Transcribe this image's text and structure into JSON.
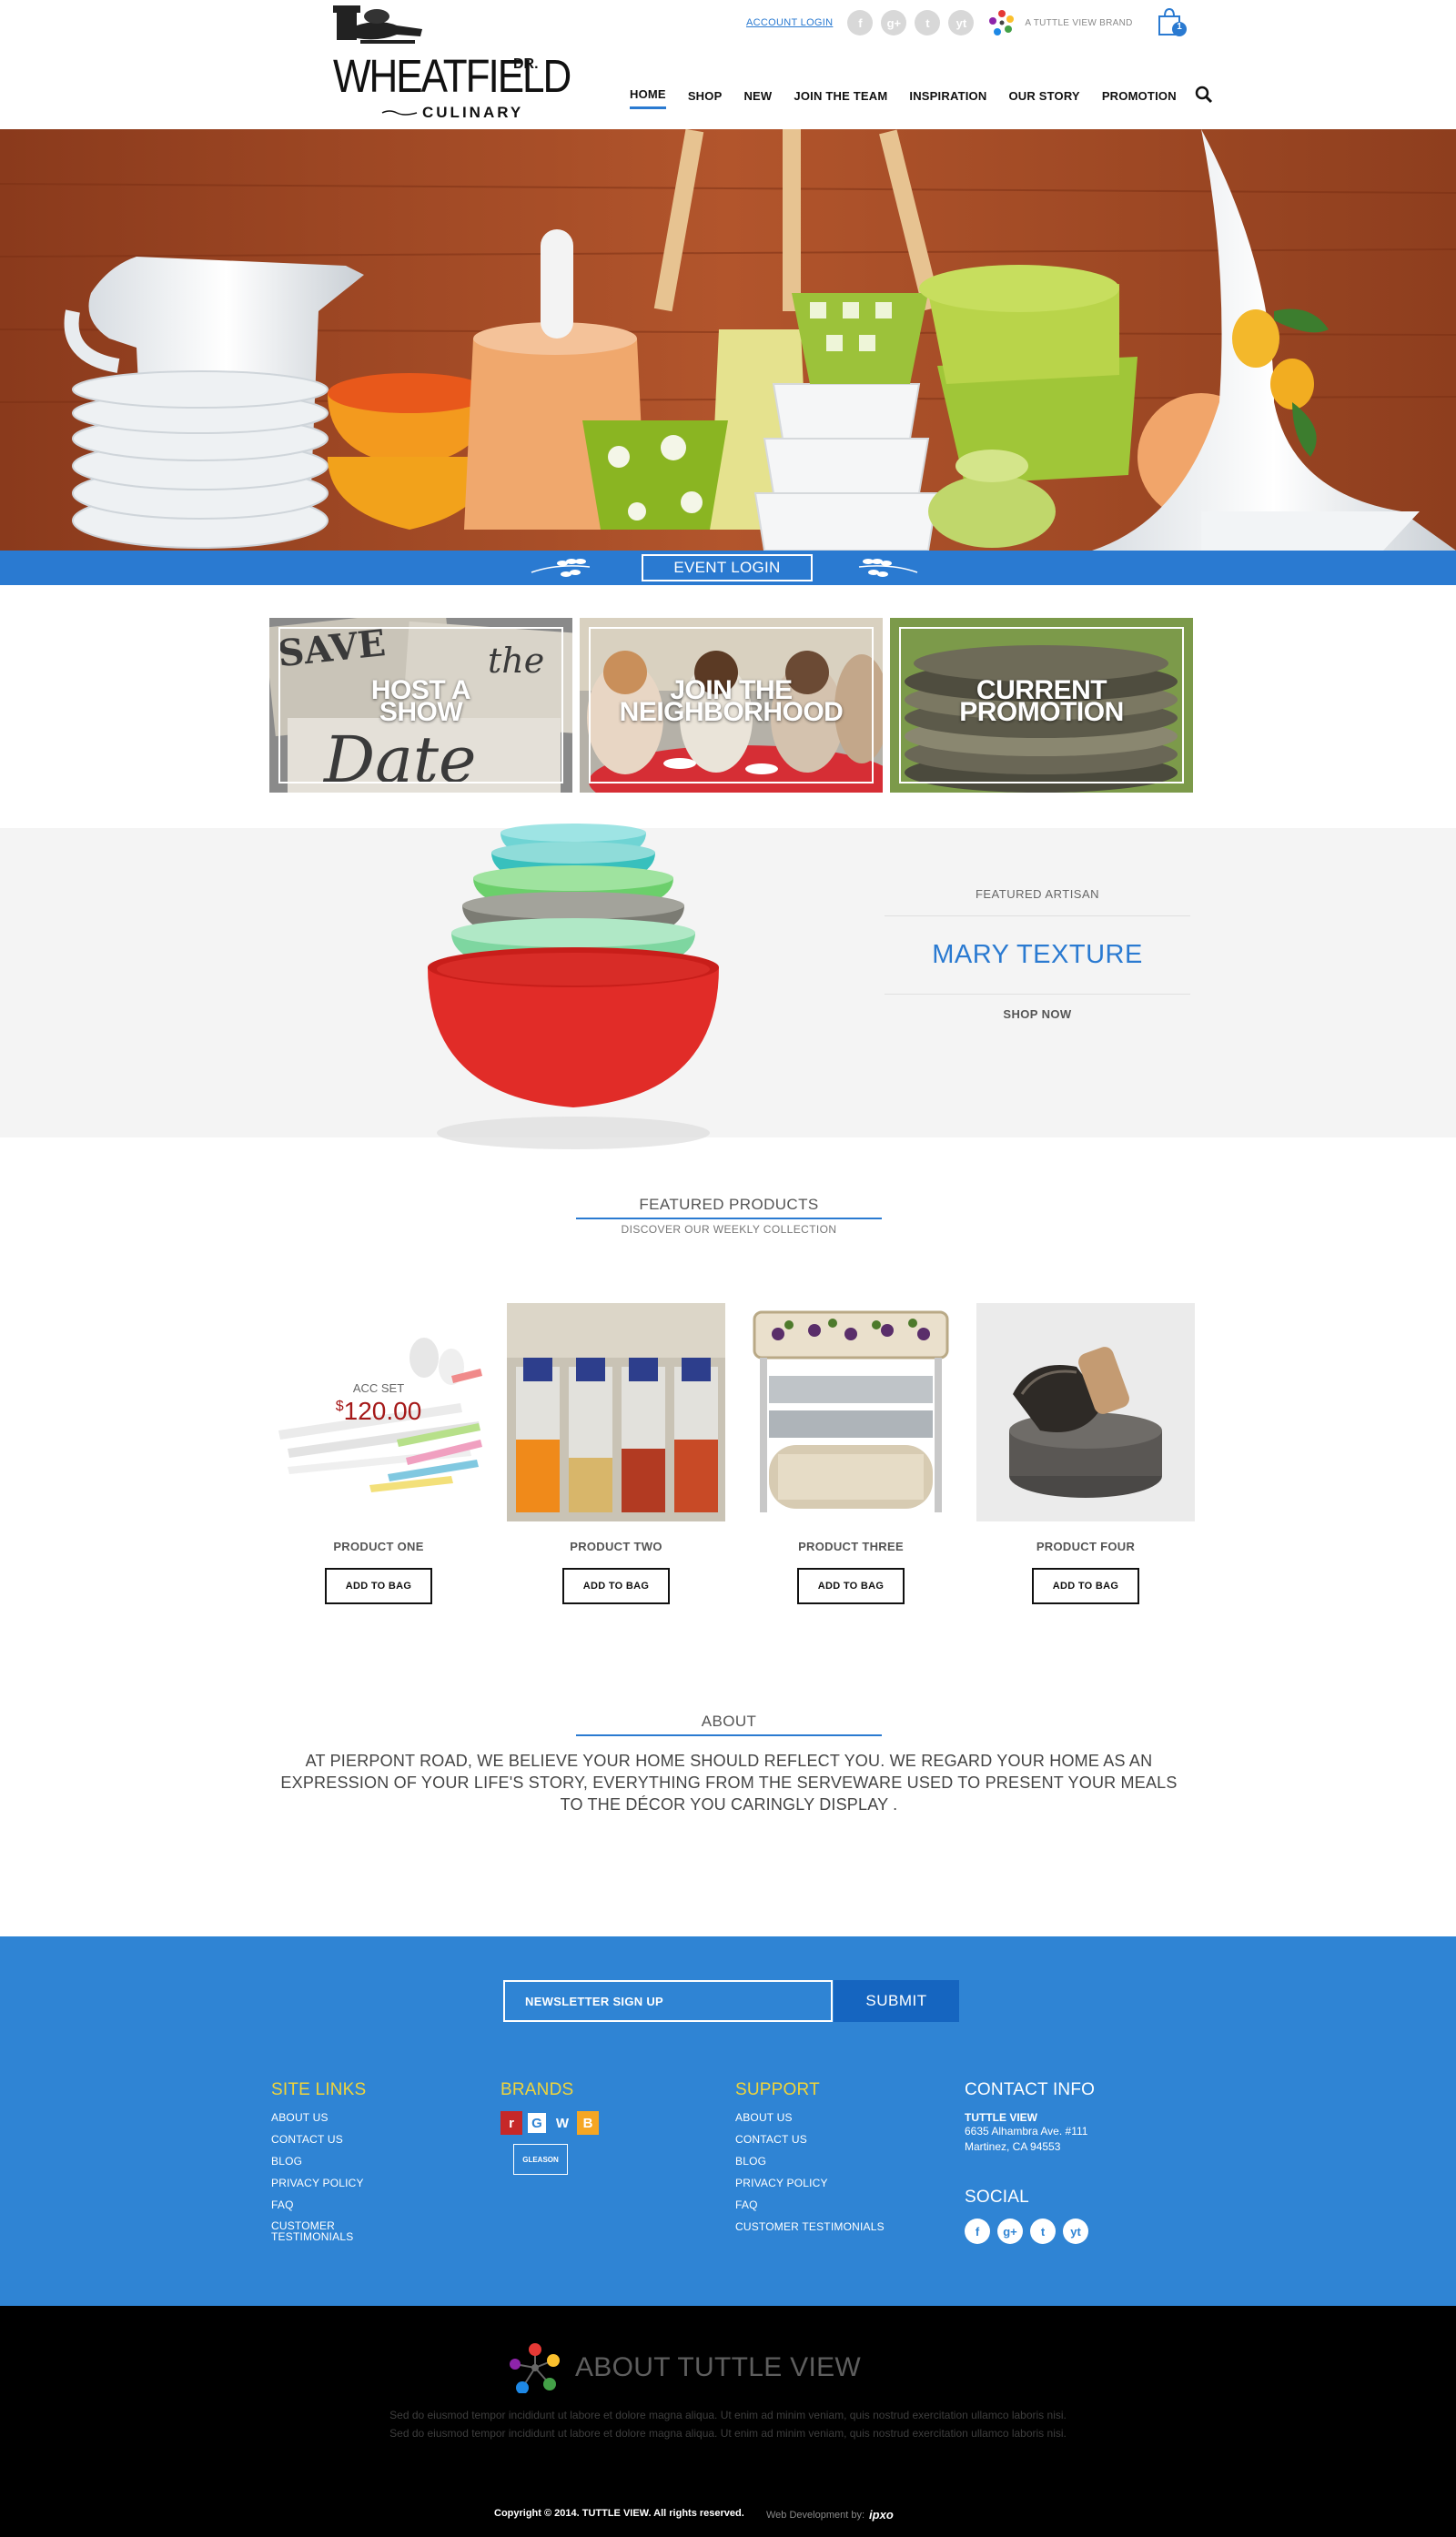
{
  "header": {
    "logo": {
      "name": "WHEATFIELD",
      "dr": "DR.",
      "sub": "CULINARY"
    },
    "account_link": "ACCOUNT LOGIN",
    "social": [
      "f",
      "g+",
      "t",
      "yt"
    ],
    "brand_tag": "A TUTTLE VIEW BRAND",
    "cart_count": "1",
    "nav": [
      "HOME",
      "SHOP",
      "NEW",
      "JOIN THE TEAM",
      "INSPIRATION",
      "OUR STORY",
      "PROMOTION"
    ],
    "active_nav": "HOME"
  },
  "event": {
    "label": "EVENT LOGIN"
  },
  "tiles": [
    {
      "label_line1": "HOST A",
      "label_line2": "SHOW"
    },
    {
      "label_line1": "JOIN THE",
      "label_line2": "NEIGHBORHOOD"
    },
    {
      "label_line1": "CURRENT",
      "label_line2": "PROMOTION"
    }
  ],
  "artisan": {
    "kicker": "FEATURED ARTISAN",
    "name": "MARY TEXTURE",
    "cta": "SHOP NOW"
  },
  "featured": {
    "title": "FEATURED PRODUCTS",
    "subtitle": "DISCOVER OUR WEEKLY COLLECTION"
  },
  "products": [
    {
      "name": "PRODUCT ONE",
      "button": "ADD TO BAG",
      "overlay_name": "ACC SET",
      "overlay_currency": "$",
      "overlay_price": "120.00"
    },
    {
      "name": "PRODUCT TWO",
      "button": "ADD TO BAG"
    },
    {
      "name": "PRODUCT THREE",
      "button": "ADD TO BAG"
    },
    {
      "name": "PRODUCT FOUR",
      "button": "ADD TO BAG"
    }
  ],
  "about": {
    "title": "ABOUT",
    "text": "AT PIERPONT ROAD, WE BELIEVE YOUR HOME SHOULD REFLECT  YOU. WE REGARD  YOUR HOME AS AN EXPRESSION OF YOUR LIFE'S STORY, EVERYTHING FROM THE SERVEWARE USED TO PRESENT YOUR MEALS TO THE DÉCOR YOU CARINGLY DISPLAY ."
  },
  "newsletter": {
    "placeholder": "NEWSLETTER SIGN UP",
    "submit": "SUBMIT"
  },
  "footer": {
    "site_links": {
      "title": "SITE LINKS",
      "items": [
        "ABOUT US",
        "CONTACT US",
        "BLOG",
        "PRIVACY POLICY",
        "FAQ",
        "CUSTOMER TESTIMONIALS"
      ]
    },
    "brands": {
      "title": "BRANDS",
      "logos": [
        "r",
        "G",
        "W",
        "B"
      ],
      "gleason": "GLEASON"
    },
    "support": {
      "title": "SUPPORT",
      "items": [
        "ABOUT US",
        "CONTACT US",
        "BLOG",
        "PRIVACY POLICY",
        "FAQ",
        "CUSTOMER TESTIMONIALS"
      ]
    },
    "contact": {
      "title": "CONTACT INFO",
      "company": "TUTTLE VIEW",
      "address1": "6635 Alhambra Ave. #111",
      "address2": "Martinez, CA 94553"
    },
    "social": {
      "title": "SOCIAL",
      "items": [
        "f",
        "g+",
        "t",
        "yt"
      ]
    }
  },
  "bottom": {
    "title": "ABOUT TUTTLE VIEW",
    "text": "Sed do eiusmod tempor incididunt ut labore et dolore magna aliqua. Ut enim ad minim veniam, quis nostrud exercitation ullamco laboris nisi. Sed do eiusmod tempor incididunt ut labore et dolore magna aliqua. Ut enim ad minim veniam, quis nostrud exercitation ullamco laboris nisi.",
    "copyright": "Copyright © 2014. TUTTLE VIEW. All rights reserved.",
    "webdev": "Web Development by:",
    "webdev_brand": "ipxo"
  },
  "colors": {
    "accent": "#2a7ad1",
    "footer_blue": "#2f84d4",
    "footer_heading": "#f0d43a",
    "price_red": "#a51919"
  }
}
